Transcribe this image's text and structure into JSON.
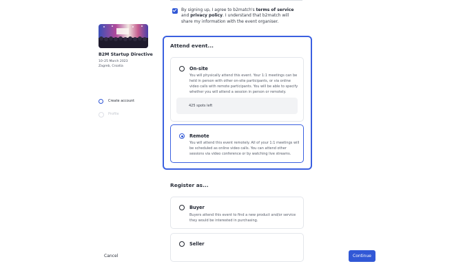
{
  "consent": {
    "checked": true,
    "text_before": "By signing up, I agree to b2match's ",
    "terms_link": "terms of service",
    "text_and": " and ",
    "privacy_link": "privacy policy",
    "text_after": ". I understand that b2match will share my information with the event organiser."
  },
  "event": {
    "title": "B2M Startup Directive",
    "dates": "10–25 March 2023",
    "location": "Zagreb, Croatia"
  },
  "steps": [
    {
      "label": "Create account",
      "state": "active"
    },
    {
      "label": "Profile",
      "state": "inactive"
    }
  ],
  "attend": {
    "title": "Attend event...",
    "options": [
      {
        "title": "On-site",
        "description": "You will physically attend this event. Your 1:1 meetings can be held in person with other on-site participants, or via online video calls with remote participants. You will be able to specify whether you will attend a session in person or remotely.",
        "spots": "425 spots left",
        "selected": false
      },
      {
        "title": "Remote",
        "description": "You will attend this event remotely. All of your 1:1 meetings will be scheduled as online video calls. You can attend other sessions via video conference or by watching live streams.",
        "selected": true
      }
    ]
  },
  "register": {
    "title": "Register as...",
    "options": [
      {
        "title": "Buyer",
        "description": "Buyers attend this event to find a new product and/or service they would be interested in purchasing."
      },
      {
        "title": "Seller"
      }
    ]
  },
  "footer": {
    "cancel_label": "Cancel",
    "continue_label": "Continue"
  },
  "colors": {
    "accent": "#3158d6",
    "panel_border": "#3a5fe0"
  }
}
